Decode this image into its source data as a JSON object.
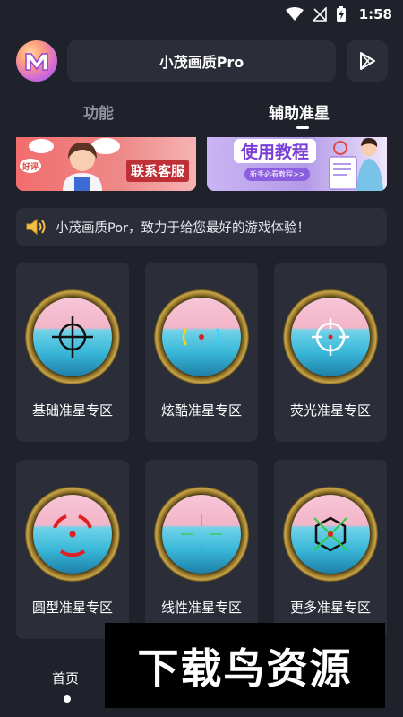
{
  "status_bar": {
    "time": "1:58"
  },
  "header": {
    "title": "小茂画质Pro",
    "avatar_icon": "app-logo-icon",
    "play_icon": "play-store-icon"
  },
  "tabs": [
    {
      "label": "功能",
      "active": false
    },
    {
      "label": "辅助准星",
      "active": true
    }
  ],
  "banners": {
    "service": {
      "label": "联系客服",
      "bubble_text": "好评"
    },
    "tutorial": {
      "label": "使用教程",
      "sub_label": "新手必看教程>>"
    }
  },
  "notice": {
    "icon": "speaker-icon",
    "text": "小茂画质Por，致力于给您最好的游戏体验！"
  },
  "cards": [
    {
      "label": "基础准星专区",
      "reticle": "crosshair-circle"
    },
    {
      "label": "炫酷准星专区",
      "reticle": "bracket-dot"
    },
    {
      "label": "荧光准星专区",
      "reticle": "circle-cross-white"
    },
    {
      "label": "圆型准星专区",
      "reticle": "red-circle-dot"
    },
    {
      "label": "线性准星专区",
      "reticle": "lines-green"
    },
    {
      "label": "更多准星专区",
      "reticle": "hexagon-cross"
    }
  ],
  "bottom_nav": {
    "home_label": "首页"
  },
  "watermark": {
    "text": "下载鸟资源"
  },
  "colors": {
    "background": "#1f222b",
    "surface": "#2b2e38",
    "accent_red": "#e02020",
    "accent_green": "#2ecc40"
  }
}
